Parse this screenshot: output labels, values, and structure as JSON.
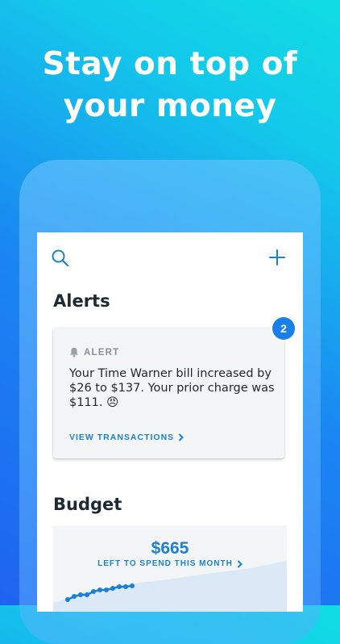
{
  "headline": {
    "line1": "Stay on top of",
    "line2": "your money"
  },
  "toolbar": {
    "search_icon": "search-icon",
    "add_icon": "plus-icon"
  },
  "alerts": {
    "title": "Alerts",
    "badge_count": "2",
    "card": {
      "label": "ALERT",
      "message": "Your Time Warner bill increased by $26 to $137. Your prior charge was $111. 😠",
      "link_label": "VIEW TRANSACTIONS"
    }
  },
  "budget": {
    "title": "Budget",
    "amount": "$665",
    "subtitle": "LEFT TO SPEND THIS MONTH"
  },
  "colors": {
    "accent": "#1b7fd6",
    "badge": "#1a7fe8",
    "background_gradient_start": "#1e63f0",
    "background_gradient_end": "#10dde3"
  }
}
